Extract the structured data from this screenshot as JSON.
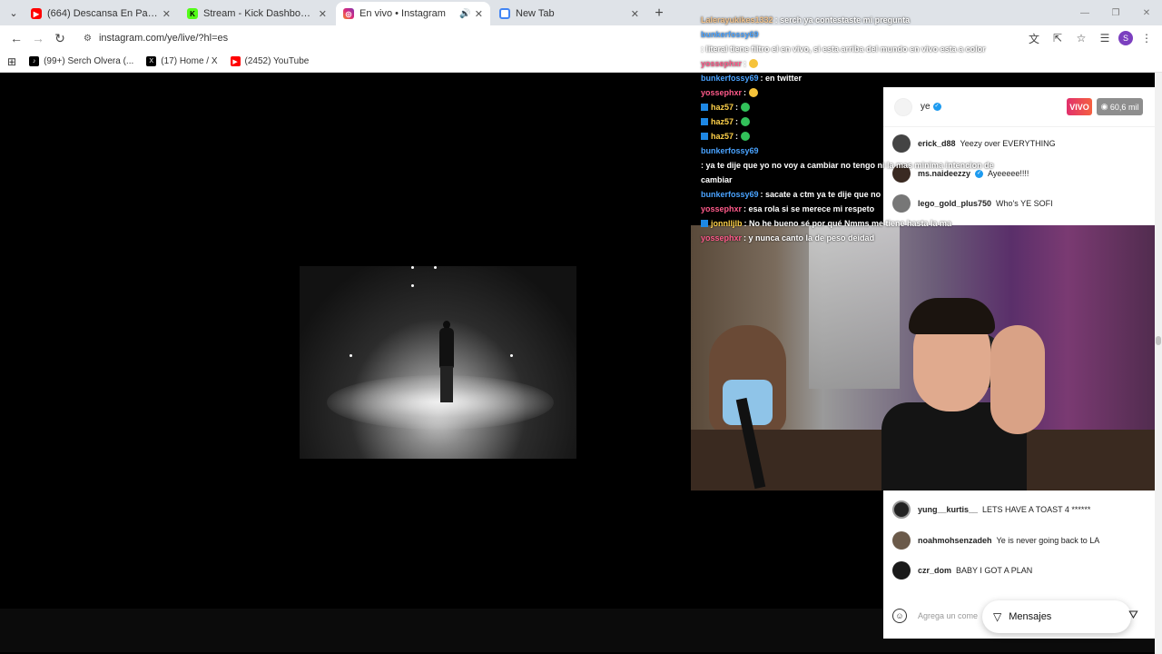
{
  "tabs": [
    {
      "title": "(664) Descansa En Paz Abuela",
      "icon": "youtube-icon",
      "color": "#ff0000",
      "active": false
    },
    {
      "title": "Stream - Kick Dashboard",
      "icon": "kick-icon",
      "color": "#53fc18",
      "active": false
    },
    {
      "title": "En vivo • Instagram",
      "icon": "instagram-icon",
      "color": "#e1306c",
      "active": true
    },
    {
      "title": "New Tab",
      "icon": "chrome-icon",
      "color": "#4285f4",
      "active": false
    }
  ],
  "url": "instagram.com/ye/live/?hl=es",
  "bookmarks": [
    {
      "label": "(99+) Serch Olvera (...",
      "icon": "tiktok-icon"
    },
    {
      "label": "(17) Home / X",
      "icon": "x-icon"
    },
    {
      "label": "(2452) YouTube",
      "icon": "youtube-icon"
    }
  ],
  "profile_initial": "S",
  "kick_chat": [
    {
      "user": "Lalerayukikes1332",
      "text": ": serch ya contestaste mi pregunta",
      "color": "c1",
      "badge": false,
      "emoji": ""
    },
    {
      "user": "bunkerfossy69",
      "text": ": literal tiene filtro el en vivo, si esta arriba del mundo en vivo esta a color",
      "color": "c2",
      "badge": false,
      "emoji": ""
    },
    {
      "user": "yossephxr",
      "text": ":",
      "color": "c3",
      "badge": false,
      "emoji": "y"
    },
    {
      "user": "bunkerfossy69",
      "text": ": en twitter",
      "color": "c2",
      "badge": false,
      "emoji": ""
    },
    {
      "user": "yossephxr",
      "text": ":",
      "color": "c3",
      "badge": false,
      "emoji": "y"
    },
    {
      "user": "haz57",
      "text": ":",
      "color": "c4",
      "badge": true,
      "emoji": "g"
    },
    {
      "user": "haz57",
      "text": ":",
      "color": "c4",
      "badge": true,
      "emoji": "g"
    },
    {
      "user": "haz57",
      "text": ":",
      "color": "c4",
      "badge": true,
      "emoji": "g"
    },
    {
      "user": "bunkerfossy69",
      "text": ": ya te dije que yo no voy a cambiar no tengo ni la mas minima intencion de cambiar",
      "color": "c2",
      "badge": false,
      "emoji": ""
    },
    {
      "user": "bunkerfossy69",
      "text": ": sacate a ctm ya te dije que no",
      "color": "c2",
      "badge": false,
      "emoji": ""
    },
    {
      "user": "yossephxr",
      "text": ": esa rola si se merece mi respeto",
      "color": "c3",
      "badge": false,
      "emoji": ""
    },
    {
      "user": "jonnlljlb",
      "text": ": No he bueno sé por qué Nmms me tiene hasta la ma",
      "color": "c4",
      "badge": true,
      "emoji": ""
    },
    {
      "user": "yossephxr",
      "text": ": y nunca canto la de peso deidad",
      "color": "c3",
      "badge": false,
      "emoji": ""
    }
  ],
  "instagram": {
    "username": "ye",
    "live_label": "VIVO",
    "viewers": "60,6 mil",
    "comments_top": [
      {
        "user": "erick_d88",
        "text": "Yeezy over EVERYTHING"
      },
      {
        "user": "ms.naideezzy",
        "text": "Ayeeeee!!!!"
      },
      {
        "user": "lego_gold_plus750",
        "text": "Who's YE SOFI"
      }
    ],
    "comments_bottom": [
      {
        "user": "yung__kurtis__",
        "text": "LETS HAVE A TOAST 4 ******"
      },
      {
        "user": "noahmohsenzadeh",
        "text": "Ye is never going back to LA"
      },
      {
        "user": "czr_dom",
        "text": "BABY I GOT A PLAN"
      }
    ],
    "comment_placeholder": "Agrega un come",
    "messages_button": "Mensajes"
  }
}
